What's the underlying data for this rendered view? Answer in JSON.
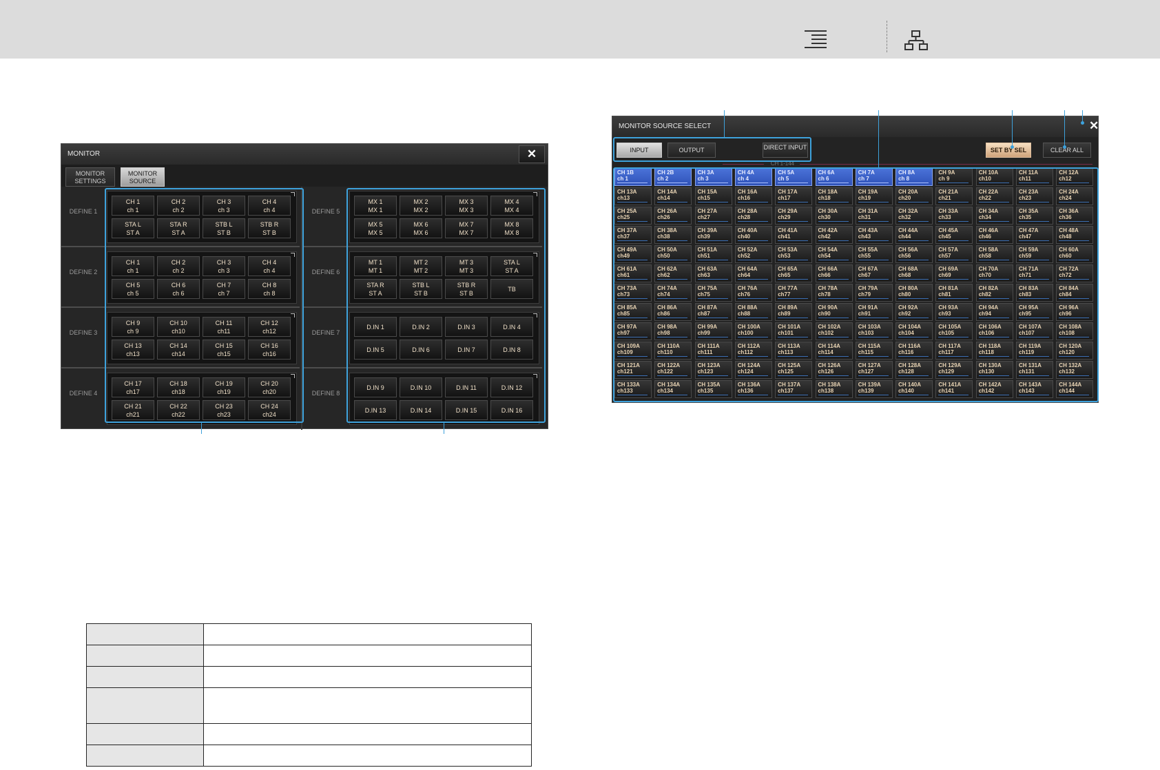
{
  "monitor": {
    "title": "MONITOR",
    "close_glyph": "✕",
    "tabs": [
      "MONITOR SETTINGS",
      "MONITOR SOURCE"
    ],
    "left_defines": [
      {
        "label": "DEFINE 1",
        "buttons": [
          [
            "CH 1",
            "ch 1"
          ],
          [
            "CH 2",
            "ch 2"
          ],
          [
            "CH 3",
            "ch 3"
          ],
          [
            "CH 4",
            "ch 4"
          ],
          [
            "STA L",
            "ST A"
          ],
          [
            "STA R",
            "ST A"
          ],
          [
            "STB L",
            "ST B"
          ],
          [
            "STB R",
            "ST B"
          ]
        ]
      },
      {
        "label": "DEFINE 2",
        "buttons": [
          [
            "CH 1",
            "ch 1"
          ],
          [
            "CH 2",
            "ch 2"
          ],
          [
            "CH 3",
            "ch 3"
          ],
          [
            "CH 4",
            "ch 4"
          ],
          [
            "CH 5",
            "ch 5"
          ],
          [
            "CH 6",
            "ch 6"
          ],
          [
            "CH 7",
            "ch 7"
          ],
          [
            "CH 8",
            "ch 8"
          ]
        ]
      },
      {
        "label": "DEFINE 3",
        "buttons": [
          [
            "CH 9",
            "ch 9"
          ],
          [
            "CH 10",
            "ch10"
          ],
          [
            "CH 11",
            "ch11"
          ],
          [
            "CH 12",
            "ch12"
          ],
          [
            "CH 13",
            "ch13"
          ],
          [
            "CH 14",
            "ch14"
          ],
          [
            "CH 15",
            "ch15"
          ],
          [
            "CH 16",
            "ch16"
          ]
        ]
      },
      {
        "label": "DEFINE 4",
        "buttons": [
          [
            "CH 17",
            "ch17"
          ],
          [
            "CH 18",
            "ch18"
          ],
          [
            "CH 19",
            "ch19"
          ],
          [
            "CH 20",
            "ch20"
          ],
          [
            "CH 21",
            "ch21"
          ],
          [
            "CH 22",
            "ch22"
          ],
          [
            "CH 23",
            "ch23"
          ],
          [
            "CH 24",
            "ch24"
          ]
        ]
      }
    ],
    "right_defines": [
      {
        "label": "DEFINE 5",
        "buttons": [
          [
            "MX 1",
            "MX 1"
          ],
          [
            "MX 2",
            "MX 2"
          ],
          [
            "MX 3",
            "MX 3"
          ],
          [
            "MX 4",
            "MX 4"
          ],
          [
            "MX 5",
            "MX 5"
          ],
          [
            "MX 6",
            "MX 6"
          ],
          [
            "MX 7",
            "MX 7"
          ],
          [
            "MX 8",
            "MX 8"
          ]
        ]
      },
      {
        "label": "DEFINE 6",
        "buttons": [
          [
            "MT 1",
            "MT 1"
          ],
          [
            "MT 2",
            "MT 2"
          ],
          [
            "MT 3",
            "MT 3"
          ],
          [
            "STA L",
            "ST A"
          ],
          [
            "STA R",
            "ST A"
          ],
          [
            "STB L",
            "ST B"
          ],
          [
            "STB R",
            "ST B"
          ],
          [
            "TB",
            ""
          ]
        ]
      },
      {
        "label": "DEFINE 7",
        "buttons": [
          [
            "D.IN 1",
            ""
          ],
          [
            "D.IN 2",
            ""
          ],
          [
            "D.IN 3",
            ""
          ],
          [
            "D.IN 4",
            ""
          ],
          [
            "D.IN 5",
            ""
          ],
          [
            "D.IN 6",
            ""
          ],
          [
            "D.IN 7",
            ""
          ],
          [
            "D.IN 8",
            ""
          ]
        ]
      },
      {
        "label": "DEFINE 8",
        "buttons": [
          [
            "D.IN 9",
            ""
          ],
          [
            "D.IN 10",
            ""
          ],
          [
            "D.IN 11",
            ""
          ],
          [
            "D.IN 12",
            ""
          ],
          [
            "D.IN 13",
            ""
          ],
          [
            "D.IN 14",
            ""
          ],
          [
            "D.IN 15",
            ""
          ],
          [
            "D.IN 16",
            ""
          ]
        ]
      }
    ]
  },
  "source_select": {
    "title": "MONITOR SOURCE SELECT",
    "close_glyph": "✕",
    "tabs": {
      "input": "INPUT",
      "output": "OUTPUT",
      "direct_input": "DIRECT INPUT"
    },
    "set_by_sel": "SET BY SEL",
    "clear_all": "CLEAR ALL",
    "range_label": "CH 1-144",
    "selected_count": 8,
    "channels": [
      [
        "CH 1B",
        "ch 1"
      ],
      [
        "CH 2B",
        "ch 2"
      ],
      [
        "CH 3A",
        "ch 3"
      ],
      [
        "CH 4A",
        "ch 4"
      ],
      [
        "CH 5A",
        "ch 5"
      ],
      [
        "CH 6A",
        "ch 6"
      ],
      [
        "CH 7A",
        "ch 7"
      ],
      [
        "CH 8A",
        "ch 8"
      ],
      [
        "CH 9A",
        "ch 9"
      ],
      [
        "CH 10A",
        "ch10"
      ],
      [
        "CH 11A",
        "ch11"
      ],
      [
        "CH 12A",
        "ch12"
      ],
      [
        "CH 13A",
        "ch13"
      ],
      [
        "CH 14A",
        "ch14"
      ],
      [
        "CH 15A",
        "ch15"
      ],
      [
        "CH 16A",
        "ch16"
      ],
      [
        "CH 17A",
        "ch17"
      ],
      [
        "CH 18A",
        "ch18"
      ],
      [
        "CH 19A",
        "ch19"
      ],
      [
        "CH 20A",
        "ch20"
      ],
      [
        "CH 21A",
        "ch21"
      ],
      [
        "CH 22A",
        "ch22"
      ],
      [
        "CH 23A",
        "ch23"
      ],
      [
        "CH 24A",
        "ch24"
      ],
      [
        "CH 25A",
        "ch25"
      ],
      [
        "CH 26A",
        "ch26"
      ],
      [
        "CH 27A",
        "ch27"
      ],
      [
        "CH 28A",
        "ch28"
      ],
      [
        "CH 29A",
        "ch29"
      ],
      [
        "CH 30A",
        "ch30"
      ],
      [
        "CH 31A",
        "ch31"
      ],
      [
        "CH 32A",
        "ch32"
      ],
      [
        "CH 33A",
        "ch33"
      ],
      [
        "CH 34A",
        "ch34"
      ],
      [
        "CH 35A",
        "ch35"
      ],
      [
        "CH 36A",
        "ch36"
      ],
      [
        "CH 37A",
        "ch37"
      ],
      [
        "CH 38A",
        "ch38"
      ],
      [
        "CH 39A",
        "ch39"
      ],
      [
        "CH 40A",
        "ch40"
      ],
      [
        "CH 41A",
        "ch41"
      ],
      [
        "CH 42A",
        "ch42"
      ],
      [
        "CH 43A",
        "ch43"
      ],
      [
        "CH 44A",
        "ch44"
      ],
      [
        "CH 45A",
        "ch45"
      ],
      [
        "CH 46A",
        "ch46"
      ],
      [
        "CH 47A",
        "ch47"
      ],
      [
        "CH 48A",
        "ch48"
      ],
      [
        "CH 49A",
        "ch49"
      ],
      [
        "CH 50A",
        "ch50"
      ],
      [
        "CH 51A",
        "ch51"
      ],
      [
        "CH 52A",
        "ch52"
      ],
      [
        "CH 53A",
        "ch53"
      ],
      [
        "CH 54A",
        "ch54"
      ],
      [
        "CH 55A",
        "ch55"
      ],
      [
        "CH 56A",
        "ch56"
      ],
      [
        "CH 57A",
        "ch57"
      ],
      [
        "CH 58A",
        "ch58"
      ],
      [
        "CH 59A",
        "ch59"
      ],
      [
        "CH 60A",
        "ch60"
      ],
      [
        "CH 61A",
        "ch61"
      ],
      [
        "CH 62A",
        "ch62"
      ],
      [
        "CH 63A",
        "ch63"
      ],
      [
        "CH 64A",
        "ch64"
      ],
      [
        "CH 65A",
        "ch65"
      ],
      [
        "CH 66A",
        "ch66"
      ],
      [
        "CH 67A",
        "ch67"
      ],
      [
        "CH 68A",
        "ch68"
      ],
      [
        "CH 69A",
        "ch69"
      ],
      [
        "CH 70A",
        "ch70"
      ],
      [
        "CH 71A",
        "ch71"
      ],
      [
        "CH 72A",
        "ch72"
      ],
      [
        "CH 73A",
        "ch73"
      ],
      [
        "CH 74A",
        "ch74"
      ],
      [
        "CH 75A",
        "ch75"
      ],
      [
        "CH 76A",
        "ch76"
      ],
      [
        "CH 77A",
        "ch77"
      ],
      [
        "CH 78A",
        "ch78"
      ],
      [
        "CH 79A",
        "ch79"
      ],
      [
        "CH 80A",
        "ch80"
      ],
      [
        "CH 81A",
        "ch81"
      ],
      [
        "CH 82A",
        "ch82"
      ],
      [
        "CH 83A",
        "ch83"
      ],
      [
        "CH 84A",
        "ch84"
      ],
      [
        "CH 85A",
        "ch85"
      ],
      [
        "CH 86A",
        "ch86"
      ],
      [
        "CH 87A",
        "ch87"
      ],
      [
        "CH 88A",
        "ch88"
      ],
      [
        "CH 89A",
        "ch89"
      ],
      [
        "CH 90A",
        "ch90"
      ],
      [
        "CH 91A",
        "ch91"
      ],
      [
        "CH 92A",
        "ch92"
      ],
      [
        "CH 93A",
        "ch93"
      ],
      [
        "CH 94A",
        "ch94"
      ],
      [
        "CH 95A",
        "ch95"
      ],
      [
        "CH 96A",
        "ch96"
      ],
      [
        "CH 97A",
        "ch97"
      ],
      [
        "CH 98A",
        "ch98"
      ],
      [
        "CH 99A",
        "ch99"
      ],
      [
        "CH 100A",
        "ch100"
      ],
      [
        "CH 101A",
        "ch101"
      ],
      [
        "CH 102A",
        "ch102"
      ],
      [
        "CH 103A",
        "ch103"
      ],
      [
        "CH 104A",
        "ch104"
      ],
      [
        "CH 105A",
        "ch105"
      ],
      [
        "CH 106A",
        "ch106"
      ],
      [
        "CH 107A",
        "ch107"
      ],
      [
        "CH 108A",
        "ch108"
      ],
      [
        "CH 109A",
        "ch109"
      ],
      [
        "CH 110A",
        "ch110"
      ],
      [
        "CH 111A",
        "ch111"
      ],
      [
        "CH 112A",
        "ch112"
      ],
      [
        "CH 113A",
        "ch113"
      ],
      [
        "CH 114A",
        "ch114"
      ],
      [
        "CH 115A",
        "ch115"
      ],
      [
        "CH 116A",
        "ch116"
      ],
      [
        "CH 117A",
        "ch117"
      ],
      [
        "CH 118A",
        "ch118"
      ],
      [
        "CH 119A",
        "ch119"
      ],
      [
        "CH 120A",
        "ch120"
      ],
      [
        "CH 121A",
        "ch121"
      ],
      [
        "CH 122A",
        "ch122"
      ],
      [
        "CH 123A",
        "ch123"
      ],
      [
        "CH 124A",
        "ch124"
      ],
      [
        "CH 125A",
        "ch125"
      ],
      [
        "CH 126A",
        "ch126"
      ],
      [
        "CH 127A",
        "ch127"
      ],
      [
        "CH 128A",
        "ch128"
      ],
      [
        "CH 129A",
        "ch129"
      ],
      [
        "CH 130A",
        "ch130"
      ],
      [
        "CH 131A",
        "ch131"
      ],
      [
        "CH 132A",
        "ch132"
      ],
      [
        "CH 133A",
        "ch133"
      ],
      [
        "CH 134A",
        "ch134"
      ],
      [
        "CH 135A",
        "ch135"
      ],
      [
        "CH 136A",
        "ch136"
      ],
      [
        "CH 137A",
        "ch137"
      ],
      [
        "CH 138A",
        "ch138"
      ],
      [
        "CH 139A",
        "ch139"
      ],
      [
        "CH 140A",
        "ch140"
      ],
      [
        "CH 141A",
        "ch141"
      ],
      [
        "CH 142A",
        "ch142"
      ],
      [
        "CH 143A",
        "ch143"
      ],
      [
        "CH 144A",
        "ch144"
      ]
    ]
  },
  "icons": {
    "header_left": "list-indent-icon",
    "header_right": "hierarchy-icon"
  },
  "colors": {
    "accent_blue": "#3ea2dc",
    "selected_channel": "#3f63c8",
    "set_by_sel": "#e8c8a4"
  },
  "table": {
    "rows": 6
  }
}
